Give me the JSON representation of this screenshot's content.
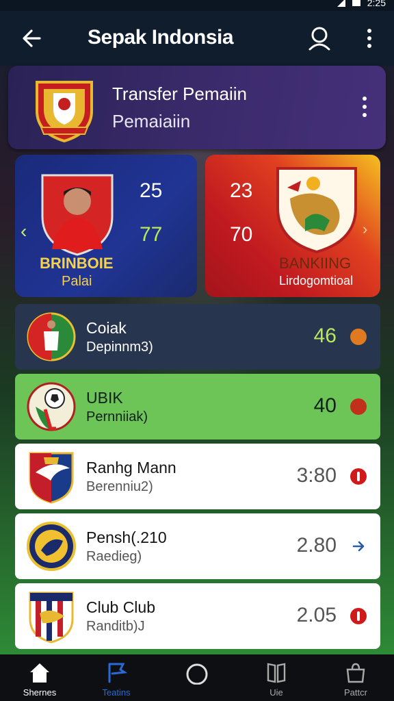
{
  "app_bar": {
    "title": "Sepak Indonsia"
  },
  "status_bar": {
    "time": "2:25"
  },
  "header_card": {
    "title": "Transfer Pemaiin",
    "subtitle": "Pemaiaiin"
  },
  "match_card": {
    "left": {
      "value_top": "25",
      "value_bottom": "77",
      "name": "BRINBOIE",
      "sub": "Palai"
    },
    "right": {
      "value_top": "23",
      "value_bottom": "70",
      "name": "BANKIING",
      "sub": "Lirdogomtioal"
    }
  },
  "list": [
    {
      "title": "Coiak",
      "sub": "Depinnm3)",
      "value": "46",
      "dot_color": "#e07a20"
    },
    {
      "title": "UBIK",
      "sub": "Pernniiak)",
      "value": "40",
      "dot_color": "#c0301a"
    },
    {
      "title": "Ranhg Mann",
      "sub": "Berenniu2)",
      "value": "3:80",
      "dot_color": "#d01a1a"
    },
    {
      "title": "Pensh(.210",
      "sub": "Raedieg)",
      "value": "2.80",
      "dot_color": "#2a5aa0"
    },
    {
      "title": "Club Club",
      "sub": "Randitb)J",
      "value": "2.05",
      "dot_color": "#d01a1a"
    }
  ],
  "bottom_nav": [
    {
      "label": "Shernes",
      "icon": "home-icon",
      "color": "#ffffff"
    },
    {
      "label": "Teatins",
      "icon": "flag-icon",
      "color": "#2a6ad8"
    },
    {
      "label": "",
      "icon": "circle-icon",
      "color": "#cccccc"
    },
    {
      "label": "Uie",
      "icon": "book-icon",
      "color": "#aaaaaa"
    },
    {
      "label": "Pattcr",
      "icon": "bag-icon",
      "color": "#aaaaaa"
    }
  ],
  "colors": {
    "accent": "#b9e85a",
    "header_card": "#3a2a6a",
    "left_card": "#1a2a7a",
    "right_card": "#c01a20"
  }
}
